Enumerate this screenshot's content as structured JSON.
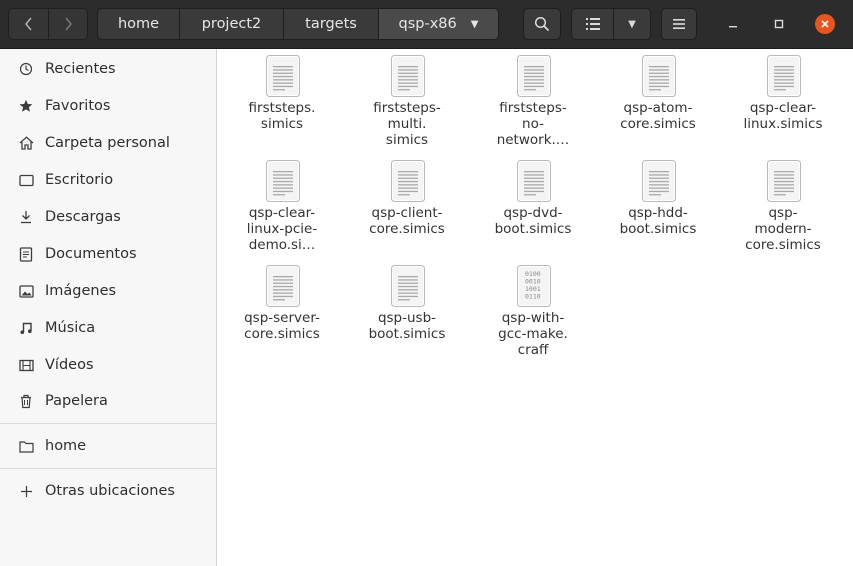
{
  "pathbar": {
    "crumbs": [
      "home",
      "project2",
      "targets",
      "qsp-x86"
    ]
  },
  "sidebar": {
    "items": [
      {
        "label": "Recientes",
        "icon": "clock-icon"
      },
      {
        "label": "Favoritos",
        "icon": "star-icon"
      },
      {
        "label": "Carpeta personal",
        "icon": "home-icon"
      },
      {
        "label": "Escritorio",
        "icon": "desktop-icon"
      },
      {
        "label": "Descargas",
        "icon": "download-icon"
      },
      {
        "label": "Documentos",
        "icon": "document-icon"
      },
      {
        "label": "Imágenes",
        "icon": "image-icon"
      },
      {
        "label": "Música",
        "icon": "music-icon"
      },
      {
        "label": "Vídeos",
        "icon": "video-icon"
      },
      {
        "label": "Papelera",
        "icon": "trash-icon"
      }
    ],
    "places": [
      {
        "label": "home",
        "icon": "folder-icon"
      }
    ],
    "other": {
      "label": "Otras ubicaciones",
      "icon": "plus-icon"
    }
  },
  "files": [
    {
      "name": "firststeps.\nsimics",
      "icon": "text-file-icon"
    },
    {
      "name": "firststeps-\nmulti.\nsimics",
      "icon": "text-file-icon"
    },
    {
      "name": "firststeps-\nno-\nnetwork.…",
      "icon": "text-file-icon"
    },
    {
      "name": "qsp-atom-\ncore.simics",
      "icon": "text-file-icon"
    },
    {
      "name": "qsp-clear-\nlinux.simics",
      "icon": "text-file-icon"
    },
    {
      "name": "qsp-clear-\nlinux-pcie-\ndemo.si…",
      "icon": "text-file-icon"
    },
    {
      "name": "qsp-client-\ncore.simics",
      "icon": "text-file-icon"
    },
    {
      "name": "qsp-dvd-\nboot.simics",
      "icon": "text-file-icon"
    },
    {
      "name": "qsp-hdd-\nboot.simics",
      "icon": "text-file-icon"
    },
    {
      "name": "qsp-\nmodern-\ncore.simics",
      "icon": "text-file-icon"
    },
    {
      "name": "qsp-server-\ncore.simics",
      "icon": "text-file-icon"
    },
    {
      "name": "qsp-usb-\nboot.simics",
      "icon": "text-file-icon"
    },
    {
      "name": "qsp-with-\ngcc-make.\ncraff",
      "icon": "binary-file-icon",
      "binary_lines": [
        "0100",
        "0010",
        "1001",
        "0110"
      ]
    }
  ],
  "colors": {
    "headerbar": "#2c2c2c",
    "close_button": "#e95420",
    "sidebar_bg": "#f7f7f7"
  }
}
